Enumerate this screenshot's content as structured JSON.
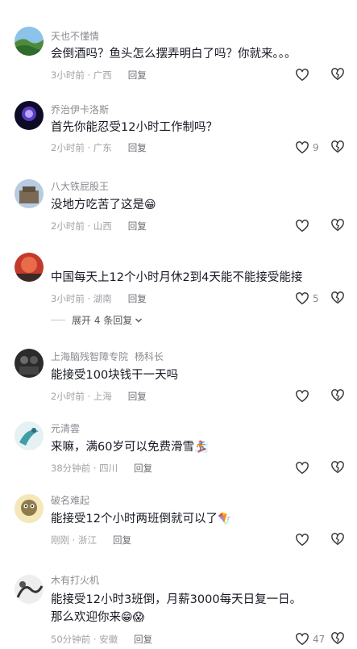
{
  "comments": [
    {
      "user": "天也不懂情",
      "tag": "",
      "text": "会倒酒吗？鱼头怎么摆弄明白了吗？你就来。。。",
      "emoji": "",
      "time": "3小时前",
      "loc": "广西",
      "reply": "回复",
      "likes": ""
    },
    {
      "user": "乔治伊卡洛斯",
      "tag": "",
      "text": "首先你能忍受12小时工作制吗？",
      "emoji": "",
      "time": "2小时前",
      "loc": "广东",
      "reply": "回复",
      "likes": "9"
    },
    {
      "user": "八大铁屁股王",
      "tag": "",
      "text": "没地方吃苦了这是",
      "emoji": "😁",
      "time": "2小时前",
      "loc": "山西",
      "reply": "回复",
      "likes": ""
    },
    {
      "user": "",
      "tag": "",
      "text": "中国每天上12个小时月休2到4天能不能接受能接",
      "emoji": "",
      "time": "3小时前",
      "loc": "湖南",
      "reply": "回复",
      "likes": "5"
    },
    {
      "user": "上海脑残智障专院",
      "tag": "杨科长",
      "text": "能接受100块钱干一天吗",
      "emoji": "",
      "time": "2小时前",
      "loc": "上海",
      "reply": "回复",
      "likes": ""
    },
    {
      "user": "元清雲",
      "tag": "",
      "text": "来嘛，满60岁可以免费滑雪",
      "emoji": "🏂",
      "time": "38分钟前",
      "loc": "四川",
      "reply": "回复",
      "likes": ""
    },
    {
      "user": "破名难起",
      "tag": "",
      "text": "能接受12个小时两班倒就可以了",
      "emoji": "🪁",
      "time": "刚刚",
      "loc": "浙江",
      "reply": "回复",
      "likes": ""
    },
    {
      "user": "木有打火机",
      "tag": "",
      "text": "能接受12小时3班倒，月薪3000每天日复一日。那么欢迎你来",
      "emoji": "😁😱",
      "time": "50分钟前",
      "loc": "安徽",
      "reply": "回复",
      "likes": "47"
    }
  ],
  "expand": {
    "label": "展开 4 条回复"
  },
  "separator": "·",
  "colors": {
    "text": "#161823",
    "secondary": "#8a8b91",
    "icon": "#2f3037"
  }
}
